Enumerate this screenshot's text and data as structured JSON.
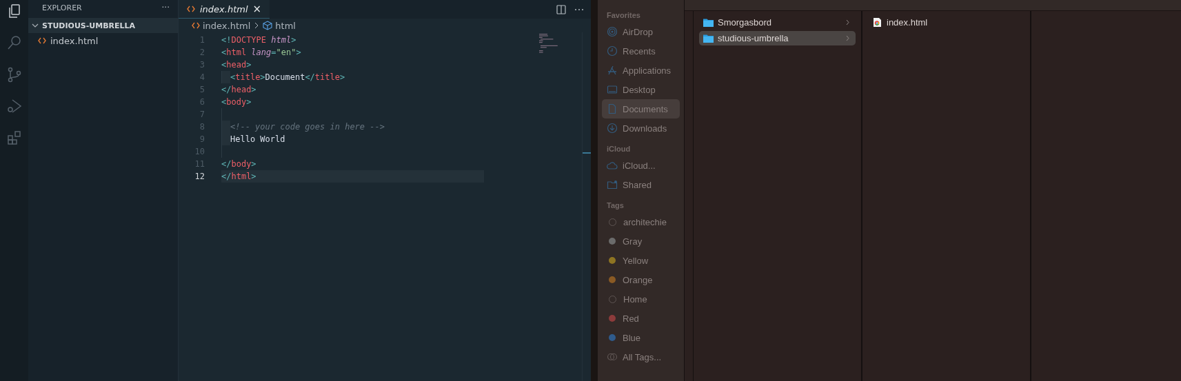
{
  "explorer": {
    "title": "EXPLORER",
    "more": "···",
    "folder": {
      "name": "STUDIOUS-UMBRELLA",
      "expanded": true,
      "children": [
        {
          "name": "index.html",
          "selected": false
        }
      ]
    }
  },
  "activity_bar": [
    {
      "kind": "files",
      "selected": true
    },
    {
      "kind": "search",
      "selected": false
    },
    {
      "kind": "scm",
      "selected": false
    },
    {
      "kind": "debug",
      "selected": false
    },
    {
      "kind": "extensions",
      "selected": false
    }
  ],
  "tabs": [
    {
      "label": "index.html",
      "close": "×",
      "selected": true
    }
  ],
  "breadcrumb": [
    "index.html",
    "html"
  ],
  "code_lines": [
    {
      "number": "1",
      "current": false,
      "indented": false,
      "tokens": [
        {
          "kind": "punct",
          "text": "<!"
        },
        {
          "kind": "tag",
          "text": "DOCTYPE "
        },
        {
          "kind": "attr",
          "text": "html"
        },
        {
          "kind": "punct",
          "text": ">"
        }
      ]
    },
    {
      "number": "2",
      "current": false,
      "indented": false,
      "tokens": [
        {
          "kind": "punct",
          "text": "<"
        },
        {
          "kind": "tag",
          "text": "html "
        },
        {
          "kind": "attr",
          "text": "lang"
        },
        {
          "kind": "punct",
          "text": "="
        },
        {
          "kind": "string",
          "text": "\"en\""
        },
        {
          "kind": "punct",
          "text": ">"
        }
      ]
    },
    {
      "number": "3",
      "current": false,
      "indented": false,
      "tokens": [
        {
          "kind": "punct",
          "text": "<"
        },
        {
          "kind": "tag",
          "text": "head"
        },
        {
          "kind": "punct",
          "text": ">"
        }
      ]
    },
    {
      "number": "4",
      "current": false,
      "indented": true,
      "tokens": [
        {
          "kind": "punct",
          "text": "<"
        },
        {
          "kind": "tag",
          "text": "title"
        },
        {
          "kind": "punct",
          "text": ">"
        },
        {
          "kind": "text",
          "text": "Document"
        },
        {
          "kind": "punct",
          "text": "</"
        },
        {
          "kind": "tag",
          "text": "title"
        },
        {
          "kind": "punct",
          "text": ">"
        }
      ]
    },
    {
      "number": "5",
      "current": false,
      "indented": false,
      "tokens": [
        {
          "kind": "punct",
          "text": "</"
        },
        {
          "kind": "tag",
          "text": "head"
        },
        {
          "kind": "punct",
          "text": ">"
        }
      ]
    },
    {
      "number": "6",
      "current": false,
      "indented": false,
      "tokens": [
        {
          "kind": "punct",
          "text": "<"
        },
        {
          "kind": "tag",
          "text": "body"
        },
        {
          "kind": "punct",
          "text": ">"
        }
      ]
    },
    {
      "number": "7",
      "current": false,
      "indented": true
    },
    {
      "number": "8",
      "current": false,
      "indented": true,
      "tokens": [
        {
          "kind": "comment",
          "text": "<!-- your code goes in here -->"
        }
      ]
    },
    {
      "number": "9",
      "current": false,
      "indented": true,
      "tokens": [
        {
          "kind": "text",
          "text": "Hello World"
        }
      ]
    },
    {
      "number": "10",
      "current": false,
      "indented": true
    },
    {
      "number": "11",
      "current": false,
      "indented": false,
      "tokens": [
        {
          "kind": "punct",
          "text": "</"
        },
        {
          "kind": "tag",
          "text": "body"
        },
        {
          "kind": "punct",
          "text": ">"
        }
      ]
    },
    {
      "number": "12",
      "current": true,
      "indented": false,
      "tokens": [
        {
          "kind": "punct",
          "text": "</"
        },
        {
          "kind": "tag",
          "text": "html"
        },
        {
          "kind": "punct",
          "text": ">"
        }
      ]
    }
  ],
  "finder_sidebar": [
    {
      "heading": "Favorites",
      "items": [
        {
          "kind": "airdrop",
          "label": "AirDrop",
          "selected": false
        },
        {
          "kind": "recents",
          "label": "Recents",
          "selected": false
        },
        {
          "kind": "applications",
          "label": "Applications",
          "selected": false
        },
        {
          "kind": "desktop",
          "label": "Desktop",
          "selected": false
        },
        {
          "kind": "documents",
          "label": "Documents",
          "selected": true
        },
        {
          "kind": "downloads",
          "label": "Downloads",
          "selected": false
        }
      ]
    },
    {
      "heading": "iCloud",
      "items": [
        {
          "kind": "cloud",
          "label": "iCloud...",
          "selected": false
        },
        {
          "kind": "shared",
          "label": "Shared",
          "selected": false
        }
      ]
    },
    {
      "heading": "Tags",
      "items": [
        {
          "kind": "hollow",
          "label": "architechie",
          "selected": false
        },
        {
          "kind": "tag",
          "color": "#6b6b6b",
          "label": "Gray",
          "selected": false
        },
        {
          "kind": "tag",
          "color": "#8e7422",
          "label": "Yellow",
          "selected": false
        },
        {
          "kind": "tag",
          "color": "#8a5a24",
          "label": "Orange",
          "selected": false
        },
        {
          "kind": "hollow",
          "label": "Home",
          "selected": false
        },
        {
          "kind": "tag",
          "color": "#8c3b3b",
          "label": "Red",
          "selected": false
        },
        {
          "kind": "tag",
          "color": "#2f5b8c",
          "label": "Blue",
          "selected": false
        },
        {
          "kind": "all",
          "label": "All Tags...",
          "selected": false
        }
      ]
    }
  ],
  "finder_columns": [
    [
      {
        "kind": "folder",
        "name": "Smorgasbord",
        "selected": false
      },
      {
        "kind": "folder",
        "name": "studious-umbrella",
        "selected": true
      }
    ],
    [
      {
        "kind": "html",
        "name": "index.html",
        "selected": false
      }
    ],
    []
  ]
}
